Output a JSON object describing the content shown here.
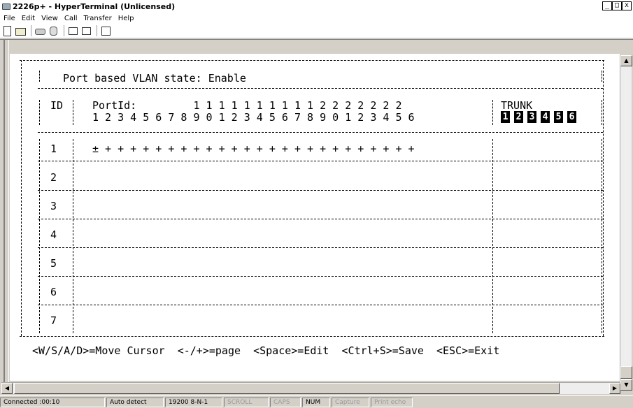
{
  "window": {
    "title": "2226p+ - HyperTerminal (Unlicensed)",
    "min_label": "_",
    "max_label": "□",
    "close_label": "x"
  },
  "menu": [
    "File",
    "Edit",
    "View",
    "Call",
    "Transfer",
    "Help"
  ],
  "toolbar_icons": [
    "new-icon",
    "open-icon",
    "connect-icon",
    "disconnect-icon",
    "send-icon",
    "receive-icon",
    "properties-icon"
  ],
  "terminal": {
    "state_line": "Port based VLAN state: Enable",
    "id_header": "ID",
    "portid_header": "PortId:",
    "port_tens": "                1 1 1 1 1 1 1 1 1 1 2 2 2 2 2 2 2",
    "port_ones": "1 2 3 4 5 6 7 8 9 0 1 2 3 4 5 6 7 8 9 0 1 2 3 4 5 6",
    "trunk_header": "TRUNK",
    "trunks": [
      "1",
      "2",
      "3",
      "4",
      "5",
      "6"
    ],
    "rows": [
      {
        "id": "1",
        "ports": "± + + + + + + + + + + + + + + + + + + + + + + + + +"
      },
      {
        "id": "2",
        "ports": ""
      },
      {
        "id": "3",
        "ports": ""
      },
      {
        "id": "4",
        "ports": ""
      },
      {
        "id": "5",
        "ports": ""
      },
      {
        "id": "6",
        "ports": ""
      },
      {
        "id": "7",
        "ports": ""
      }
    ],
    "help_line": "<W/S/A/D>=Move Cursor  <-/+>=page  <Space>=Edit  <Ctrl+S>=Save  <ESC>=Exit"
  },
  "status": {
    "connected": "Connected :00:10",
    "detect": "Auto detect",
    "settings": "19200 8-N-1",
    "scroll": "SCROLL",
    "caps": "CAPS",
    "num": "NUM",
    "capture": "Capture",
    "print_echo": "Print echo"
  }
}
